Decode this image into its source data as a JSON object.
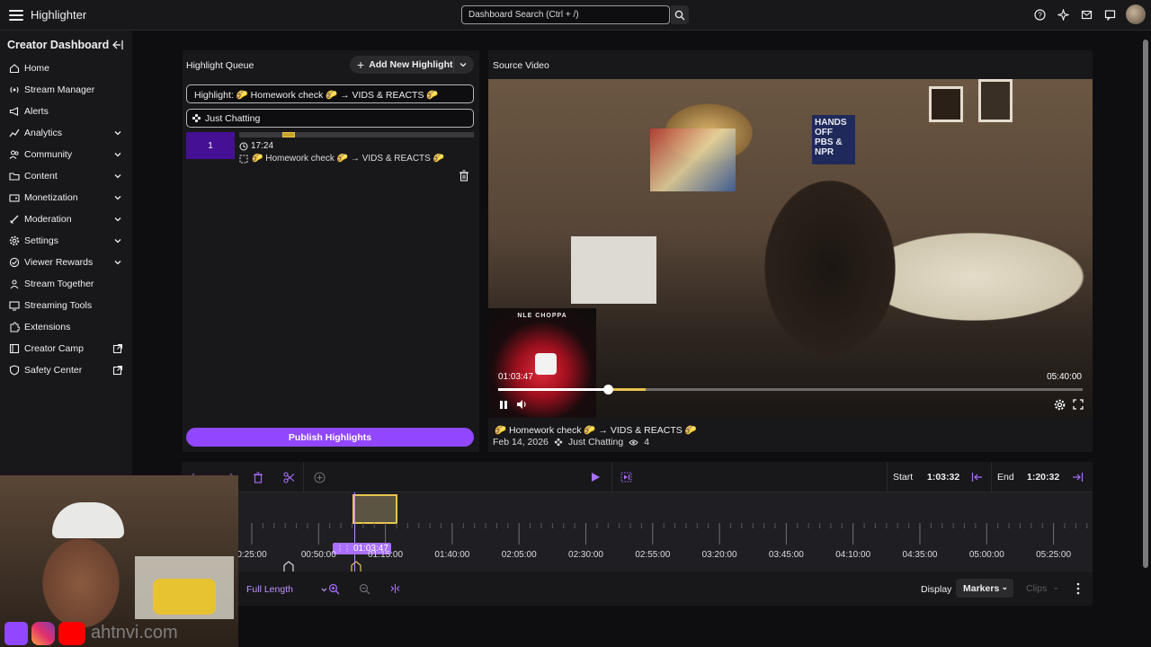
{
  "app": {
    "title": "Highlighter"
  },
  "search": {
    "placeholder": "Dashboard Search (Ctrl + /)"
  },
  "sidebar": {
    "heading": "Creator Dashboard",
    "items": [
      {
        "label": "Home",
        "icon": "home-icon",
        "expandable": false,
        "external": false
      },
      {
        "label": "Stream Manager",
        "icon": "broadcast-icon",
        "expandable": false,
        "external": false
      },
      {
        "label": "Alerts",
        "icon": "megaphone-icon",
        "expandable": false,
        "external": false
      },
      {
        "label": "Analytics",
        "icon": "chart-icon",
        "expandable": true,
        "external": false
      },
      {
        "label": "Community",
        "icon": "people-icon",
        "expandable": true,
        "external": false
      },
      {
        "label": "Content",
        "icon": "folder-icon",
        "expandable": true,
        "external": false
      },
      {
        "label": "Monetization",
        "icon": "wallet-icon",
        "expandable": true,
        "external": false
      },
      {
        "label": "Moderation",
        "icon": "sword-icon",
        "expandable": true,
        "external": false
      },
      {
        "label": "Settings",
        "icon": "gear-icon",
        "expandable": true,
        "external": false
      },
      {
        "label": "Viewer Rewards",
        "icon": "reward-icon",
        "expandable": true,
        "external": false
      },
      {
        "label": "Stream Together",
        "icon": "together-icon",
        "expandable": false,
        "external": false
      },
      {
        "label": "Streaming Tools",
        "icon": "tools-icon",
        "expandable": false,
        "external": false
      },
      {
        "label": "Extensions",
        "icon": "puzzle-icon",
        "expandable": false,
        "external": false
      },
      {
        "label": "Creator Camp",
        "icon": "book-icon",
        "expandable": false,
        "external": true
      },
      {
        "label": "Safety Center",
        "icon": "shield-icon",
        "expandable": false,
        "external": true
      }
    ]
  },
  "queue": {
    "title": "Highlight Queue",
    "add_label": "Add New Highlight",
    "highlight_title": "Highlight: 🌮 Homework check 🌮 → VIDS & REACTS 🌮",
    "category": "Just Chatting",
    "item": {
      "index": "1",
      "duration": "17:24",
      "clip_name": "🌮 Homework check 🌮 → VIDS & REACTS 🌮"
    },
    "publish_label": "Publish Highlights"
  },
  "source": {
    "title": "Source Video",
    "time_current": "01:03:47",
    "time_total": "05:40:00",
    "progress": 0.188,
    "album_text": "NLE CHOPPA",
    "poster_text": "HANDS OFF PBS & NPR",
    "stream_title": "🌮 Homework check 🌮 → VIDS & REACTS 🌮",
    "date": "Feb 14, 2026",
    "category": "Just Chatting",
    "views": "4"
  },
  "timeline": {
    "start_label": "Start",
    "start_value": "1:03:32",
    "end_label": "End",
    "end_value": "1:20:32",
    "cursor_time": "01:03:47",
    "tick_labels": [
      "0:25:00",
      "00:50:00",
      "01:15:00",
      "01:40:00",
      "02:05:00",
      "02:30:00",
      "02:55:00",
      "03:20:00",
      "03:45:00",
      "04:10:00",
      "04:35:00",
      "05:00:00",
      "05:25:00"
    ],
    "zoom_mode": "Full Length",
    "display_label": "Display",
    "markers_label": "Markers",
    "clips_label": "Clips"
  },
  "overlay": {
    "handle": "ahtnvi.com"
  },
  "colors": {
    "accent": "#9147ff",
    "accent_dark": "#451093",
    "highlight": "#e9c44f",
    "bg": "#0e0e10",
    "panel": "#18181b"
  }
}
